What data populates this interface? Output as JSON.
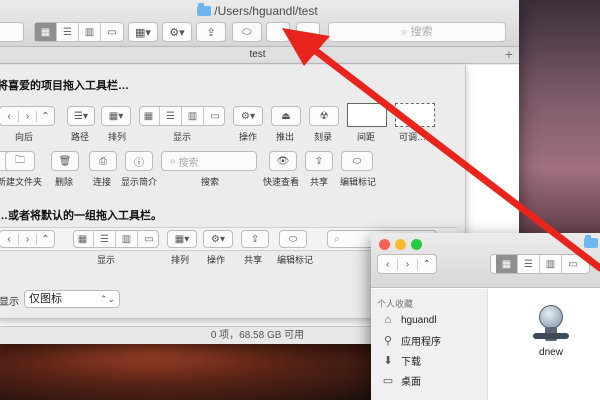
{
  "main_window": {
    "title": "/Users/hguandl/test",
    "tab_label": "test",
    "search_placeholder": "搜索",
    "tab_add": "+",
    "status": "0 项，68.58 GB 可用"
  },
  "customize_sheet": {
    "drag_items_heading": "将喜爱的项目拖入工具栏…",
    "default_set_heading": "…或者将默认的一组拖入工具栏。",
    "item_labels": {
      "back": "向后",
      "path": "路径",
      "arrange": "排列",
      "view": "显示",
      "action": "操作",
      "eject": "推出",
      "burn": "刻录",
      "space": "间距",
      "flexible_space": "可调…",
      "new_folder": "新建文件夹",
      "delete": "删除",
      "connect": "连接",
      "get_info": "显示简介",
      "search": "搜索",
      "quick_look": "快速查看",
      "share": "共享",
      "edit_tags": "编辑标记"
    },
    "default_labels": {
      "view": "显示",
      "arrange": "排列",
      "action": "操作",
      "share": "共享",
      "edit_tags": "编辑标记"
    },
    "search_field_placeholder": "搜索",
    "show_label": "显示",
    "show_select_value": "仅图标"
  },
  "second_window": {
    "sidebar_heading": "个人收藏",
    "sidebar_items": [
      "hguandl",
      "应用程序",
      "下载",
      "桌面"
    ],
    "file_name": "dnew"
  },
  "colors": {
    "arrow": "#e8241c",
    "folder_blue": "#6fb6ee",
    "segment_selected": "#8f8f8f"
  }
}
